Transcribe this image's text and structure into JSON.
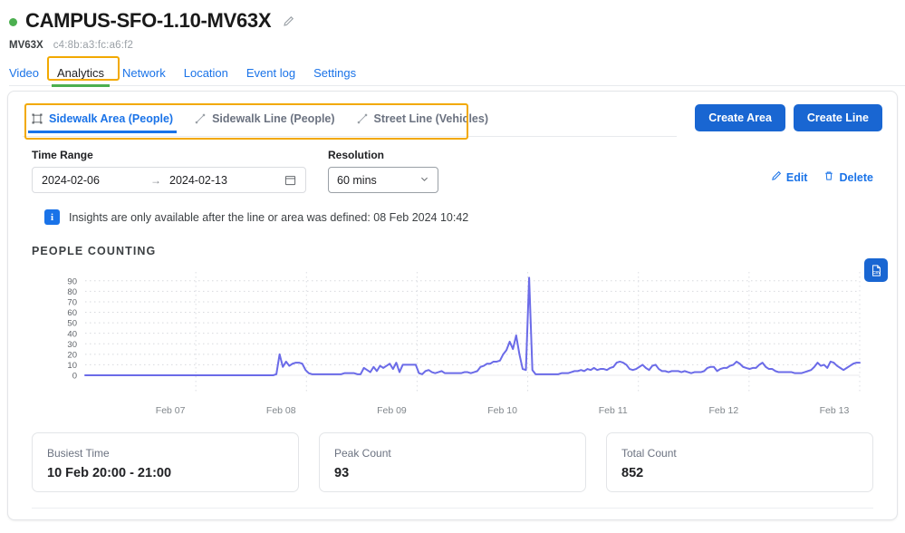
{
  "header": {
    "status": "online",
    "status_color": "#4CAF50",
    "title": "CAMPUS-SFO-1.10-MV63X",
    "edit_icon": "pencil-icon",
    "model": "MV63X",
    "mac": "c4:8b:a3:fc:a6:f2"
  },
  "nav_tabs": [
    {
      "label": "Video",
      "active": false
    },
    {
      "label": "Analytics",
      "active": true
    },
    {
      "label": "Network",
      "active": false
    },
    {
      "label": "Location",
      "active": false
    },
    {
      "label": "Event log",
      "active": false
    },
    {
      "label": "Settings",
      "active": false
    }
  ],
  "analytic_tabs": [
    {
      "label": "Sidewalk Area (People)",
      "icon": "area-shape-icon",
      "active": true
    },
    {
      "label": "Sidewalk Line (People)",
      "icon": "line-shape-icon",
      "active": false
    },
    {
      "label": "Street Line (Vehicles)",
      "icon": "line-shape-icon",
      "active": false
    }
  ],
  "toolbar": {
    "create_area_label": "Create Area",
    "create_line_label": "Create Line",
    "edit_label": "Edit",
    "delete_label": "Delete",
    "primary_color": "#1966d2",
    "highlight_color": "#F2A900"
  },
  "filters": {
    "time_range_label": "Time Range",
    "start_date": "2024-02-06",
    "range_arrow": "→",
    "end_date": "2024-02-13",
    "calendar_icon": "calendar-icon",
    "resolution_label": "Resolution",
    "resolution_value": "60 mins",
    "resolution_options": [
      "60 mins"
    ]
  },
  "info_banner": {
    "icon": "info-icon",
    "text": "Insights are only available after the line or area was defined: 08 Feb 2024 10:42"
  },
  "section": {
    "title": "PEOPLE COUNTING",
    "export_icon": "csv-download-icon"
  },
  "stats": [
    {
      "label": "Busiest Time",
      "value": "10 Feb 20:00 - 21:00"
    },
    {
      "label": "Peak Count",
      "value": "93"
    },
    {
      "label": "Total Count",
      "value": "852"
    }
  ],
  "chart_data": {
    "type": "line",
    "title": "PEOPLE COUNTING",
    "xlabel": "",
    "ylabel": "",
    "line_color": "#6b6be8",
    "grid": true,
    "legend": "none",
    "ylim": [
      0,
      95
    ],
    "yticks": [
      0,
      10,
      20,
      30,
      40,
      50,
      60,
      70,
      80,
      90
    ],
    "xticks": [
      "Feb 07",
      "Feb 08",
      "Feb 09",
      "Feb 10",
      "Feb 11",
      "Feb 12",
      "Feb 13"
    ],
    "xlim": [
      "2024-02-06 00:00",
      "2024-02-13 00:00"
    ],
    "resolution": "60 mins",
    "peak_value": 93,
    "total_count": 852,
    "busiest_time": "10 Feb 20:00 - 21:00",
    "values": [
      0,
      0,
      0,
      0,
      0,
      0,
      0,
      0,
      0,
      0,
      0,
      0,
      0,
      0,
      0,
      0,
      0,
      0,
      0,
      0,
      0,
      0,
      0,
      0,
      0,
      0,
      0,
      0,
      0,
      0,
      0,
      0,
      0,
      0,
      0,
      0,
      0,
      0,
      0,
      0,
      0,
      0,
      0,
      0,
      0,
      0,
      0,
      0,
      0,
      0,
      0,
      0,
      0,
      0,
      0,
      0,
      0,
      0,
      0,
      1,
      20,
      8,
      13,
      9,
      11,
      12,
      12,
      11,
      5,
      2,
      1,
      1,
      1,
      1,
      1,
      1,
      1,
      1,
      1,
      1,
      2,
      2,
      2,
      2,
      1,
      1,
      7,
      5,
      3,
      8,
      4,
      9,
      7,
      9,
      11,
      6,
      12,
      3,
      10,
      10,
      10,
      10,
      10,
      2,
      1,
      4,
      5,
      3,
      2,
      3,
      4,
      2,
      2,
      2,
      2,
      2,
      2,
      3,
      3,
      2,
      3,
      4,
      8,
      9,
      11,
      11,
      13,
      13,
      14,
      20,
      24,
      32,
      25,
      38,
      20,
      6,
      5,
      93,
      5,
      1,
      1,
      1,
      1,
      1,
      1,
      1,
      1,
      2,
      2,
      2,
      3,
      4,
      4,
      5,
      4,
      6,
      5,
      7,
      5,
      6,
      6,
      5,
      7,
      8,
      12,
      13,
      12,
      10,
      6,
      5,
      6,
      8,
      10,
      7,
      5,
      9,
      10,
      6,
      4,
      4,
      3,
      4,
      4,
      4,
      3,
      4,
      3,
      2,
      3,
      3,
      3,
      4,
      7,
      8,
      8,
      4,
      6,
      7,
      7,
      9,
      10,
      13,
      11,
      8,
      7,
      6,
      7,
      7,
      10,
      12,
      8,
      6,
      6,
      4,
      3,
      3,
      3,
      3,
      3,
      2,
      2,
      2,
      3,
      4,
      5,
      8,
      12,
      9,
      10,
      7,
      13,
      12,
      9,
      7,
      5,
      7,
      9,
      11,
      12,
      12
    ]
  }
}
